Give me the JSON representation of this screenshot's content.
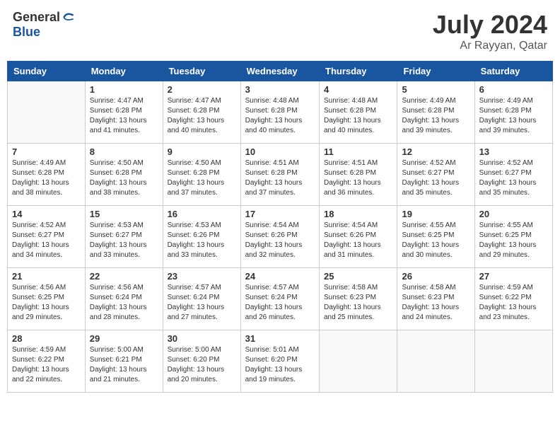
{
  "header": {
    "logo_general": "General",
    "logo_blue": "Blue",
    "month_title": "July 2024",
    "location": "Ar Rayyan, Qatar"
  },
  "weekdays": [
    "Sunday",
    "Monday",
    "Tuesday",
    "Wednesday",
    "Thursday",
    "Friday",
    "Saturday"
  ],
  "weeks": [
    [
      {
        "day": "",
        "sunrise": "",
        "sunset": "",
        "daylight": ""
      },
      {
        "day": "1",
        "sunrise": "Sunrise: 4:47 AM",
        "sunset": "Sunset: 6:28 PM",
        "daylight": "Daylight: 13 hours and 41 minutes."
      },
      {
        "day": "2",
        "sunrise": "Sunrise: 4:47 AM",
        "sunset": "Sunset: 6:28 PM",
        "daylight": "Daylight: 13 hours and 40 minutes."
      },
      {
        "day": "3",
        "sunrise": "Sunrise: 4:48 AM",
        "sunset": "Sunset: 6:28 PM",
        "daylight": "Daylight: 13 hours and 40 minutes."
      },
      {
        "day": "4",
        "sunrise": "Sunrise: 4:48 AM",
        "sunset": "Sunset: 6:28 PM",
        "daylight": "Daylight: 13 hours and 40 minutes."
      },
      {
        "day": "5",
        "sunrise": "Sunrise: 4:49 AM",
        "sunset": "Sunset: 6:28 PM",
        "daylight": "Daylight: 13 hours and 39 minutes."
      },
      {
        "day": "6",
        "sunrise": "Sunrise: 4:49 AM",
        "sunset": "Sunset: 6:28 PM",
        "daylight": "Daylight: 13 hours and 39 minutes."
      }
    ],
    [
      {
        "day": "7",
        "sunrise": "Sunrise: 4:49 AM",
        "sunset": "Sunset: 6:28 PM",
        "daylight": "Daylight: 13 hours and 38 minutes."
      },
      {
        "day": "8",
        "sunrise": "Sunrise: 4:50 AM",
        "sunset": "Sunset: 6:28 PM",
        "daylight": "Daylight: 13 hours and 38 minutes."
      },
      {
        "day": "9",
        "sunrise": "Sunrise: 4:50 AM",
        "sunset": "Sunset: 6:28 PM",
        "daylight": "Daylight: 13 hours and 37 minutes."
      },
      {
        "day": "10",
        "sunrise": "Sunrise: 4:51 AM",
        "sunset": "Sunset: 6:28 PM",
        "daylight": "Daylight: 13 hours and 37 minutes."
      },
      {
        "day": "11",
        "sunrise": "Sunrise: 4:51 AM",
        "sunset": "Sunset: 6:28 PM",
        "daylight": "Daylight: 13 hours and 36 minutes."
      },
      {
        "day": "12",
        "sunrise": "Sunrise: 4:52 AM",
        "sunset": "Sunset: 6:27 PM",
        "daylight": "Daylight: 13 hours and 35 minutes."
      },
      {
        "day": "13",
        "sunrise": "Sunrise: 4:52 AM",
        "sunset": "Sunset: 6:27 PM",
        "daylight": "Daylight: 13 hours and 35 minutes."
      }
    ],
    [
      {
        "day": "14",
        "sunrise": "Sunrise: 4:52 AM",
        "sunset": "Sunset: 6:27 PM",
        "daylight": "Daylight: 13 hours and 34 minutes."
      },
      {
        "day": "15",
        "sunrise": "Sunrise: 4:53 AM",
        "sunset": "Sunset: 6:27 PM",
        "daylight": "Daylight: 13 hours and 33 minutes."
      },
      {
        "day": "16",
        "sunrise": "Sunrise: 4:53 AM",
        "sunset": "Sunset: 6:26 PM",
        "daylight": "Daylight: 13 hours and 33 minutes."
      },
      {
        "day": "17",
        "sunrise": "Sunrise: 4:54 AM",
        "sunset": "Sunset: 6:26 PM",
        "daylight": "Daylight: 13 hours and 32 minutes."
      },
      {
        "day": "18",
        "sunrise": "Sunrise: 4:54 AM",
        "sunset": "Sunset: 6:26 PM",
        "daylight": "Daylight: 13 hours and 31 minutes."
      },
      {
        "day": "19",
        "sunrise": "Sunrise: 4:55 AM",
        "sunset": "Sunset: 6:25 PM",
        "daylight": "Daylight: 13 hours and 30 minutes."
      },
      {
        "day": "20",
        "sunrise": "Sunrise: 4:55 AM",
        "sunset": "Sunset: 6:25 PM",
        "daylight": "Daylight: 13 hours and 29 minutes."
      }
    ],
    [
      {
        "day": "21",
        "sunrise": "Sunrise: 4:56 AM",
        "sunset": "Sunset: 6:25 PM",
        "daylight": "Daylight: 13 hours and 29 minutes."
      },
      {
        "day": "22",
        "sunrise": "Sunrise: 4:56 AM",
        "sunset": "Sunset: 6:24 PM",
        "daylight": "Daylight: 13 hours and 28 minutes."
      },
      {
        "day": "23",
        "sunrise": "Sunrise: 4:57 AM",
        "sunset": "Sunset: 6:24 PM",
        "daylight": "Daylight: 13 hours and 27 minutes."
      },
      {
        "day": "24",
        "sunrise": "Sunrise: 4:57 AM",
        "sunset": "Sunset: 6:24 PM",
        "daylight": "Daylight: 13 hours and 26 minutes."
      },
      {
        "day": "25",
        "sunrise": "Sunrise: 4:58 AM",
        "sunset": "Sunset: 6:23 PM",
        "daylight": "Daylight: 13 hours and 25 minutes."
      },
      {
        "day": "26",
        "sunrise": "Sunrise: 4:58 AM",
        "sunset": "Sunset: 6:23 PM",
        "daylight": "Daylight: 13 hours and 24 minutes."
      },
      {
        "day": "27",
        "sunrise": "Sunrise: 4:59 AM",
        "sunset": "Sunset: 6:22 PM",
        "daylight": "Daylight: 13 hours and 23 minutes."
      }
    ],
    [
      {
        "day": "28",
        "sunrise": "Sunrise: 4:59 AM",
        "sunset": "Sunset: 6:22 PM",
        "daylight": "Daylight: 13 hours and 22 minutes."
      },
      {
        "day": "29",
        "sunrise": "Sunrise: 5:00 AM",
        "sunset": "Sunset: 6:21 PM",
        "daylight": "Daylight: 13 hours and 21 minutes."
      },
      {
        "day": "30",
        "sunrise": "Sunrise: 5:00 AM",
        "sunset": "Sunset: 6:20 PM",
        "daylight": "Daylight: 13 hours and 20 minutes."
      },
      {
        "day": "31",
        "sunrise": "Sunrise: 5:01 AM",
        "sunset": "Sunset: 6:20 PM",
        "daylight": "Daylight: 13 hours and 19 minutes."
      },
      {
        "day": "",
        "sunrise": "",
        "sunset": "",
        "daylight": ""
      },
      {
        "day": "",
        "sunrise": "",
        "sunset": "",
        "daylight": ""
      },
      {
        "day": "",
        "sunrise": "",
        "sunset": "",
        "daylight": ""
      }
    ]
  ]
}
